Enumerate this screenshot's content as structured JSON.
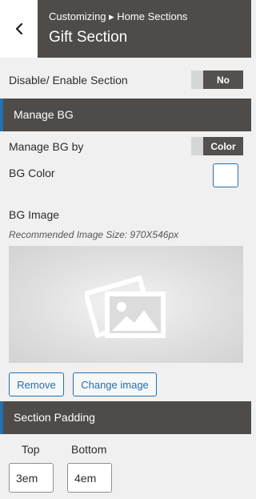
{
  "header": {
    "breadcrumb": "Customizing ▸ Home Sections",
    "title": "Gift Section"
  },
  "section_toggle": {
    "label": "Disable/ Enable Section",
    "value": "No"
  },
  "manage_bg": {
    "heading": "Manage BG",
    "manage_by_label": "Manage BG by",
    "manage_by_value": "Color",
    "bg_color_label": "BG Color",
    "bg_color_value": "#ffffff",
    "bg_image_label": "BG Image",
    "image_hint": "Recommended Image Size: 970X546px",
    "remove_label": "Remove",
    "change_image_label": "Change image"
  },
  "section_padding": {
    "heading": "Section Padding",
    "top_label": "Top",
    "top_value": "3em",
    "bottom_label": "Bottom",
    "bottom_value": "4em"
  },
  "colors": {
    "header_bg": "#4f4b48",
    "accent": "#2271b1",
    "panel_bg": "#f0f0f1"
  },
  "icons": {
    "back": "chevron-left-icon",
    "image_placeholder": "image-icon"
  }
}
